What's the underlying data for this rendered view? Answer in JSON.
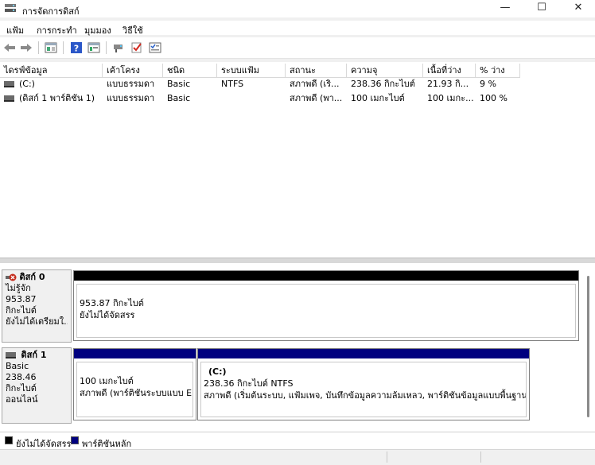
{
  "window": {
    "title": "การจัดการดิสก์",
    "controls": {
      "minimize": "—",
      "maximize": "☐",
      "close": "✕"
    }
  },
  "menu": [
    "แฟ้ม",
    "การกระทำ",
    "มุมมอง",
    "วิธีใช้"
  ],
  "toolbar_icons": [
    "back-icon",
    "forward-icon",
    "disk-list-icon",
    "help-icon",
    "properties-icon",
    "connect-icon",
    "check-icon",
    "settings-list-icon"
  ],
  "volume_list": {
    "columns": [
      "ไดรฟ์ข้อมูล",
      "เค้าโครง",
      "ชนิด",
      "ระบบแฟ้ม",
      "สถานะ",
      "ความจุ",
      "เนื้อที่ว่าง",
      "% ว่าง"
    ],
    "rows": [
      [
        "(C:)",
        "แบบธรรมดา",
        "Basic",
        "NTFS",
        "สภาพดี (เริ...",
        "238.36 กิกะไบต์",
        "21.93 กิ...",
        "9 %"
      ],
      [
        "(ดิสก์ 1 พาร์ติชัน 1)",
        "แบบธรรมดา",
        "Basic",
        "",
        "สภาพดี (พา...",
        "100 เมกะไบต์",
        "100 เมกะ...",
        "100 %"
      ]
    ]
  },
  "disks": [
    {
      "name": "ดิสก์ 0",
      "type": "ไม่รู้จัก",
      "size": "953.87 กิกะไบต์",
      "status": "ยังไม่ได้เตรียมใ...",
      "partitions": [
        {
          "line1": "953.87 กิกะไบต์",
          "line2": "ยังไม่ได้จัดสรร",
          "line3": "",
          "color": "#000000"
        }
      ]
    },
    {
      "name": "ดิสก์ 1",
      "type": "Basic",
      "size": "238.46 กิกะไบต์",
      "status": "ออนไลน์",
      "partitions": [
        {
          "line1": "",
          "line2": "100 เมกะไบต์",
          "line3": "สภาพดี (พาร์ติชันระบบแบบ EFI",
          "color": "#00007f"
        },
        {
          "line1": "(C:)",
          "line2": "238.36 กิกะไบต์ NTFS",
          "line3": "สภาพดี (เริ่มต้นระบบ, แฟ้มเพจ, บันทึกข้อมูลความล้มเหลว, พาร์ติชันข้อมูลแบบพื้นฐาน)",
          "color": "#00007f"
        }
      ]
    }
  ],
  "legend": [
    {
      "label": "ยังไม่ได้จัดสรร",
      "color": "#000000"
    },
    {
      "label": "พาร์ติชันหลัก",
      "color": "#00007f"
    }
  ]
}
